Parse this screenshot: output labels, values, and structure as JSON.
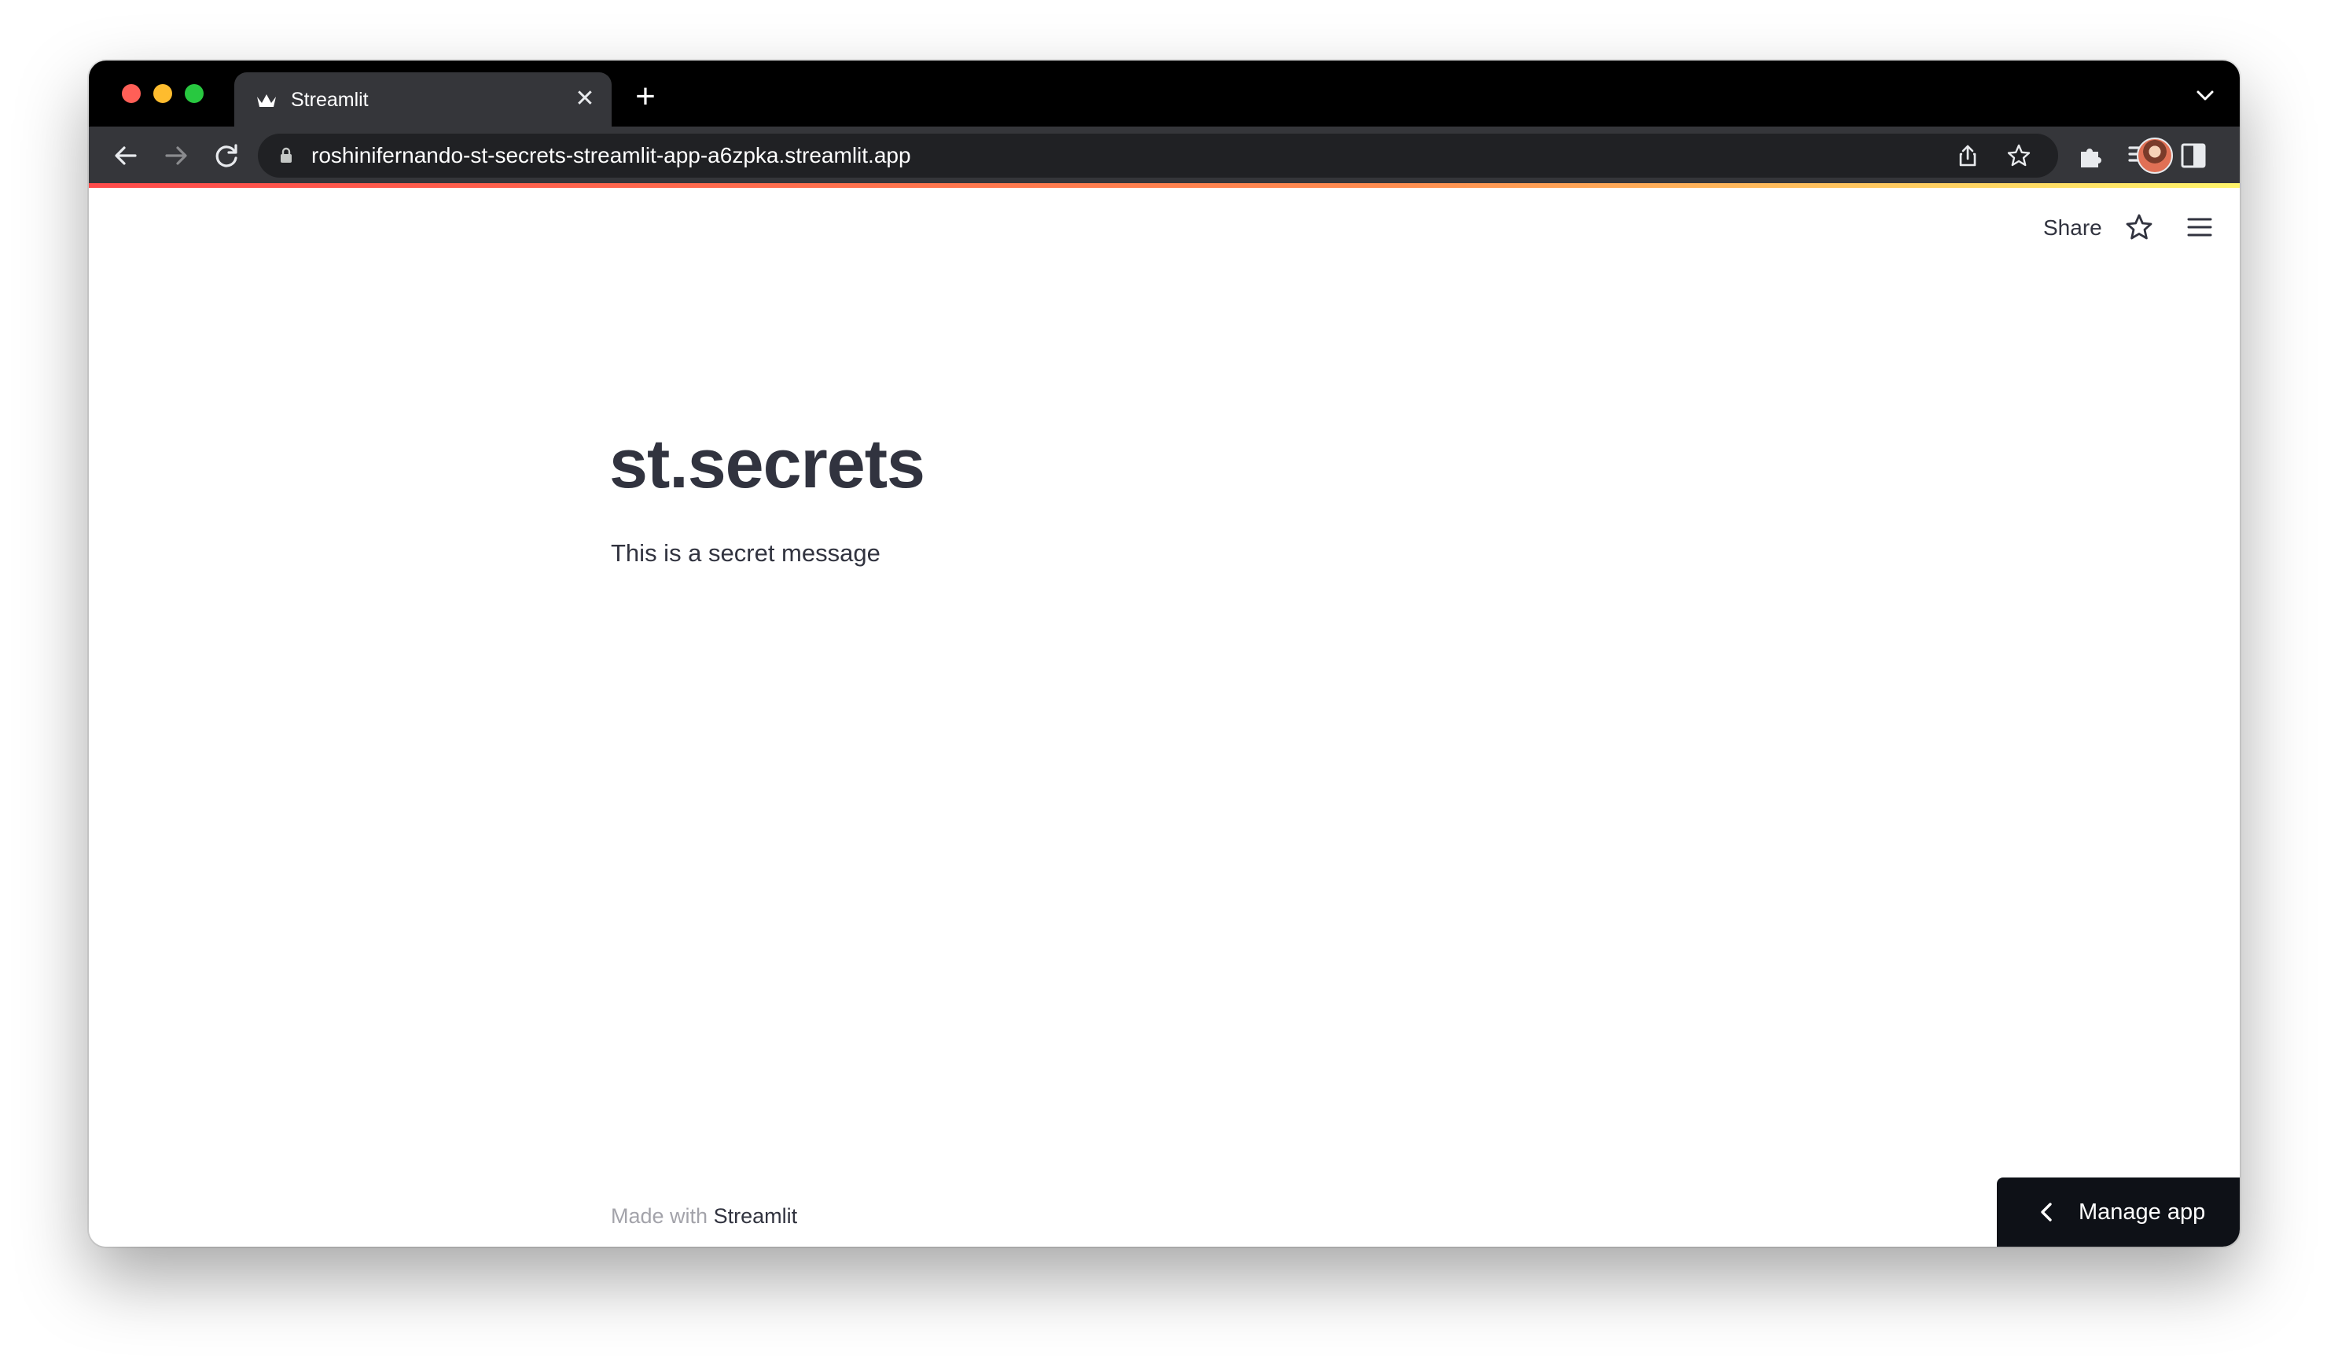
{
  "browser": {
    "tab": {
      "title": "Streamlit",
      "close_glyph": "✕"
    },
    "new_tab_glyph": "+",
    "url": "roshinifernando-st-secrets-streamlit-app-a6zpka.streamlit.app",
    "icons": {
      "back": "arrow-left-icon",
      "forward": "arrow-right-icon",
      "reload": "reload-icon",
      "lock": "lock-icon",
      "share": "share-icon",
      "bookmark": "star-icon",
      "extensions": "puzzle-icon",
      "media": "media-control-icon",
      "side_panel": "side-panel-icon",
      "profile": "avatar",
      "more": "kebab-menu-icon",
      "tab_search": "chevron-down-icon"
    },
    "colors": {
      "tab_bar": "#000000",
      "toolbar": "#35363a",
      "omnibox": "#202124",
      "accent_gradient_start": "#ff4b4b",
      "accent_gradient_end": "#fff56b"
    }
  },
  "app_header": {
    "share_label": "Share",
    "star_icon": "star-icon",
    "menu_icon": "hamburger-menu-icon"
  },
  "main": {
    "title": "st.secrets",
    "message": "This is a secret message"
  },
  "footer": {
    "prefix": "Made with",
    "brand": "Streamlit"
  },
  "manage_app": {
    "label": "Manage app",
    "icon": "chevron-left-icon"
  }
}
